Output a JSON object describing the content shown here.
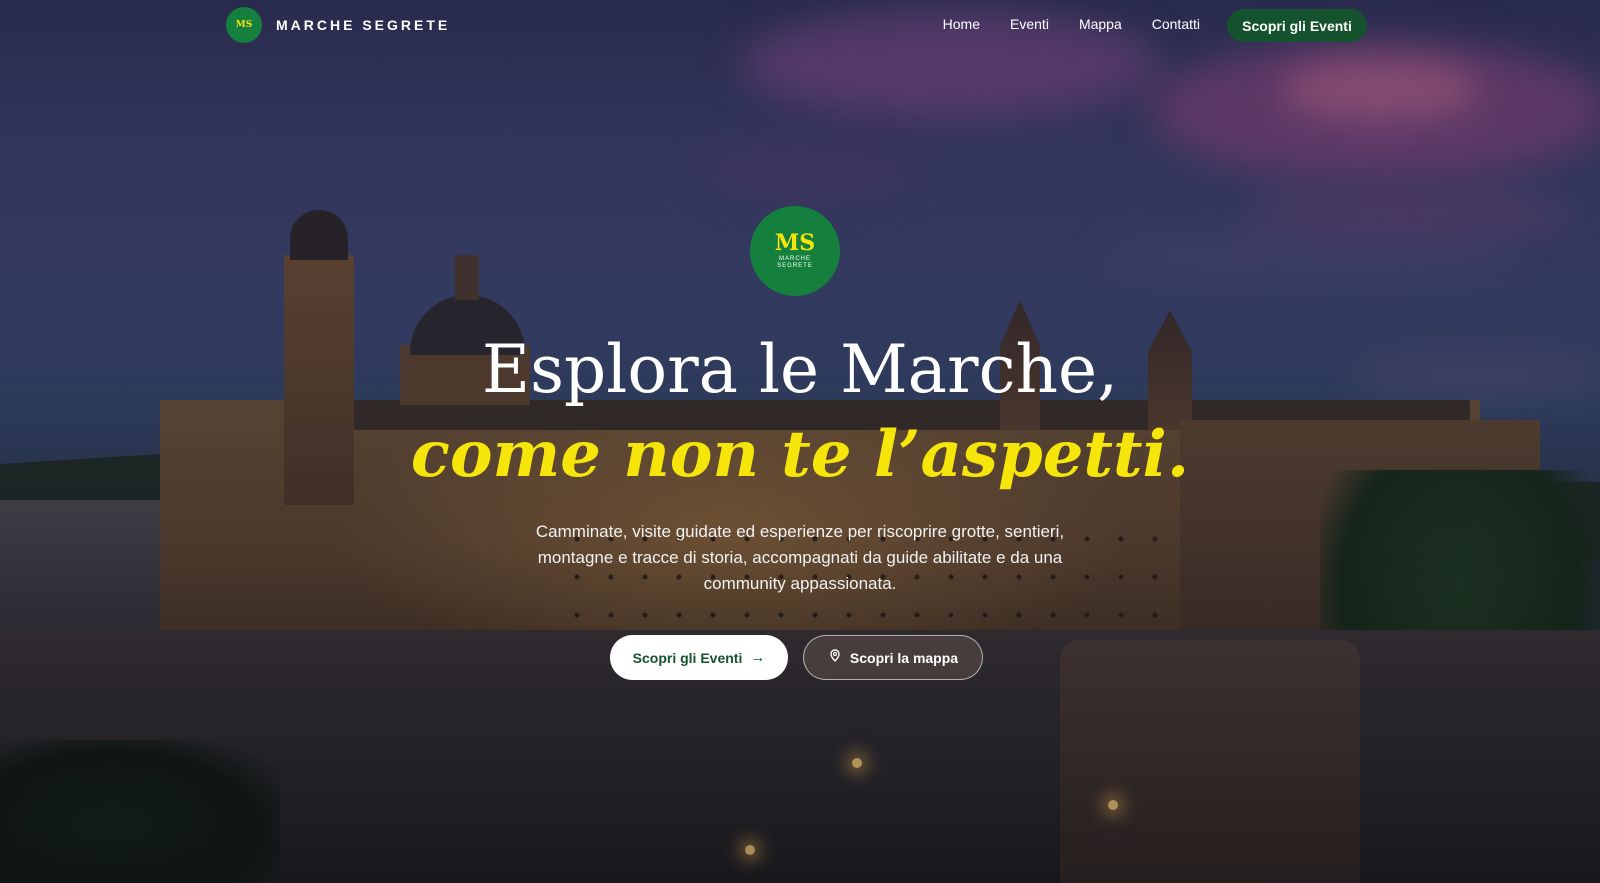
{
  "brand": {
    "logo_text": "MS",
    "name": "MARCHE SEGRETE"
  },
  "nav": {
    "links": [
      "Home",
      "Eventi",
      "Mappa",
      "Contatti"
    ],
    "cta_label": "Scopri gli Eventi"
  },
  "hero": {
    "logo_mark": "MS",
    "logo_subtitle": "MARCHE SEGRETE",
    "headline": "Esplora le Marche,",
    "headline_accent": "come non te l’aspetti.",
    "lead": "Camminate, visite guidate ed esperienze per riscoprire grotte, sentieri, montagne e tracce di storia, accompagnati da guide abilitate e da una community appassionata.",
    "primary_button": "Scopri gli Eventi",
    "primary_icon": "arrow-right-icon",
    "secondary_button": "Scopri la mappa",
    "secondary_icon": "map-pin-icon"
  },
  "colors": {
    "brand_green": "#14532d",
    "logo_green": "#15803d",
    "accent_yellow": "#f5e50a"
  }
}
